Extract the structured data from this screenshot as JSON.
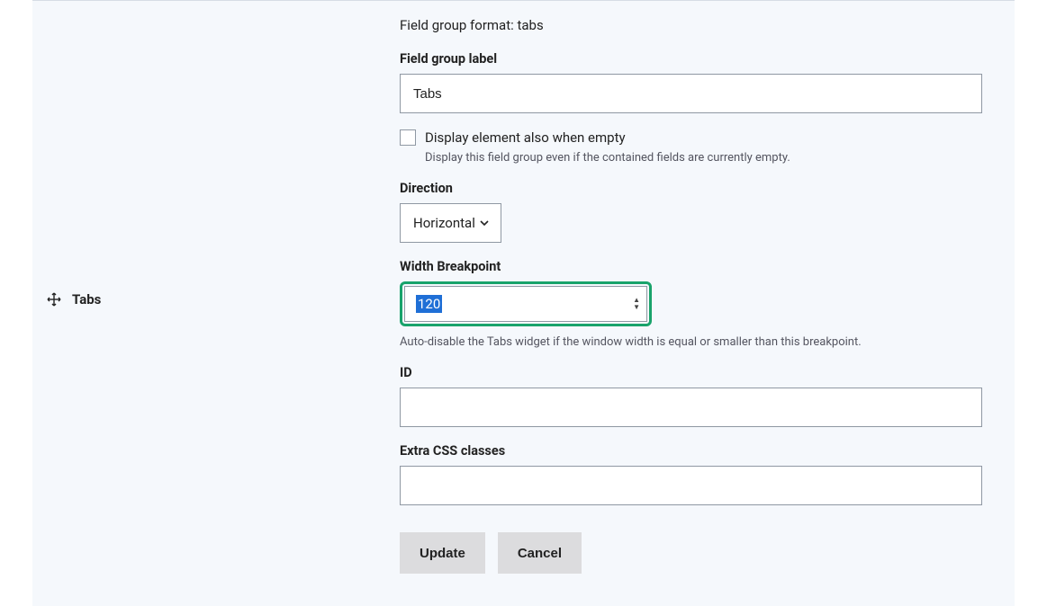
{
  "row": {
    "title": "Tabs"
  },
  "format": {
    "prefix": "Field group format: ",
    "value": "tabs"
  },
  "labelField": {
    "label": "Field group label",
    "value": "Tabs"
  },
  "displayEmpty": {
    "label": "Display element also when empty",
    "help": "Display this field group even if the contained fields are currently empty."
  },
  "direction": {
    "label": "Direction",
    "value": "Horizontal"
  },
  "breakpoint": {
    "label": "Width Breakpoint",
    "value": "120",
    "desc": "Auto-disable the Tabs widget if the window width is equal or smaller than this breakpoint."
  },
  "id": {
    "label": "ID",
    "value": ""
  },
  "css": {
    "label": "Extra CSS classes",
    "value": ""
  },
  "buttons": {
    "update": "Update",
    "cancel": "Cancel"
  }
}
